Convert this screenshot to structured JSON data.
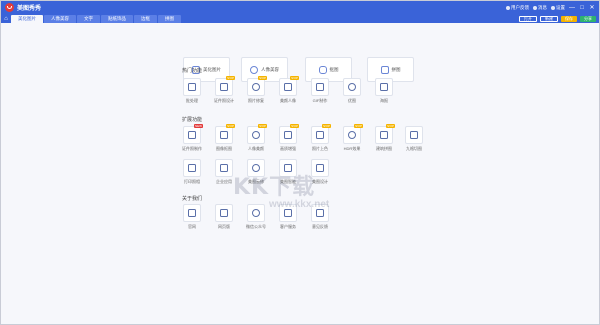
{
  "app": {
    "title": "美图秀秀"
  },
  "titlebar": {
    "items": [
      "用户反馈",
      "消息",
      "设置"
    ],
    "buttons": [
      "—",
      "□",
      "✕"
    ]
  },
  "tabs": [
    {
      "label": "美化图片",
      "active": true
    },
    {
      "label": "人像美容",
      "active": false
    },
    {
      "label": "文字",
      "active": false
    },
    {
      "label": "贴纸饰品",
      "active": false
    },
    {
      "label": "边框",
      "active": false
    },
    {
      "label": "拼图",
      "active": false
    }
  ],
  "toolbar": {
    "open": "打开",
    "new": "新建",
    "save": "保存",
    "share": "分享"
  },
  "main_cards": [
    "美化图片",
    "人像美容",
    "抠图",
    "拼图"
  ],
  "sections": {
    "hot": "热门功能",
    "ext": "扩展功能",
    "about": "关于我们"
  },
  "hot_tools": [
    {
      "label": "批处理",
      "badge": ""
    },
    {
      "label": "证件照设计",
      "badge": "SVIP"
    },
    {
      "label": "照片修复",
      "badge": "SVIP"
    },
    {
      "label": "美颜人像",
      "badge": "SVIP"
    },
    {
      "label": "GIF制作",
      "badge": ""
    },
    {
      "label": "优图",
      "badge": ""
    },
    {
      "label": "海报",
      "badge": ""
    }
  ],
  "ext_tools": [
    {
      "label": "证件照制作",
      "badge": "NEW"
    },
    {
      "label": "图像抠图",
      "badge": "SVIP"
    },
    {
      "label": "人像美颜",
      "badge": "SVIP"
    },
    {
      "label": "画质增强",
      "badge": "SVIP"
    },
    {
      "label": "照片上色",
      "badge": "SVIP"
    },
    {
      "label": "HDR效果",
      "badge": "SVIP"
    },
    {
      "label": "建筑拼图",
      "badge": "SVIP"
    },
    {
      "label": "九格切图",
      "badge": ""
    }
  ],
  "ext_tools2": [
    {
      "label": "打印照相",
      "badge": ""
    },
    {
      "label": "企业应用",
      "badge": ""
    },
    {
      "label": "美图云修",
      "badge": ""
    },
    {
      "label": "美图智能",
      "badge": ""
    },
    {
      "label": "美图设计",
      "badge": ""
    }
  ],
  "about": [
    {
      "label": "官网",
      "badge": ""
    },
    {
      "label": "网页版",
      "badge": ""
    },
    {
      "label": "微信公众号",
      "badge": ""
    },
    {
      "label": "客户服务",
      "badge": ""
    },
    {
      "label": "意见反馈",
      "badge": ""
    }
  ],
  "watermark": {
    "line1": "KK下载",
    "line2": "www.kkx.net"
  },
  "colors": {
    "primary": "#3a63d8",
    "badge": "#f5b400",
    "new": "#e23a3a"
  }
}
